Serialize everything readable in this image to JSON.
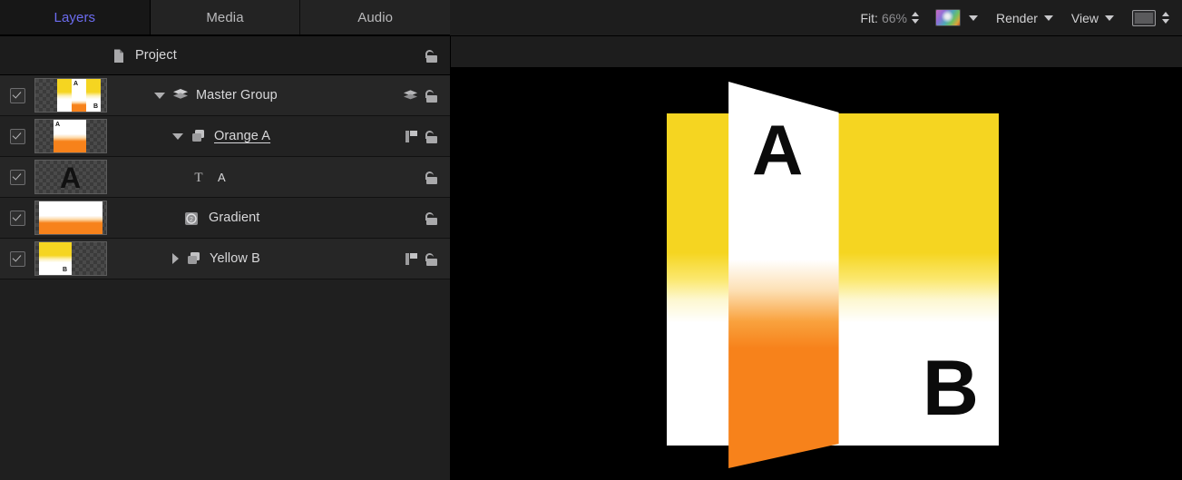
{
  "tabs": [
    {
      "id": "layers",
      "label": "Layers",
      "active": true
    },
    {
      "id": "media",
      "label": "Media",
      "active": false
    },
    {
      "id": "audio",
      "label": "Audio",
      "active": false
    }
  ],
  "toolbar": {
    "fit_label": "Fit:",
    "fit_value": "66%",
    "fit_stepper_icon": "stepper-up-down-icon",
    "color_swatch_icon": "color-wheel-swatch-icon",
    "color_swatch_chevron_icon": "chevron-down-icon",
    "render_label": "Render",
    "render_chevron_icon": "chevron-down-icon",
    "view_label": "View",
    "view_chevron_icon": "chevron-down-icon",
    "mask_button_icon": "rectangle-mask-icon",
    "mask_stepper_icon": "stepper-up-down-icon"
  },
  "layers_panel": {
    "project_row": {
      "icon": "document-icon",
      "label": "Project",
      "lock_icon": "unlocked-padlock-icon"
    },
    "rows": [
      {
        "id": "master-group",
        "label": "Master Group",
        "enabled": true,
        "checkbox_icon": "checkbox-checked-icon",
        "indent": 0,
        "disclosure": "open",
        "disclosure_icon": "triangle-down-icon",
        "kind_icon": "group-stack-icon",
        "extra_icon": "layers-stack-icon",
        "lock_icon": "unlocked-padlock-icon",
        "editing": false,
        "thumb": {
          "style": "master",
          "letters": [
            "A",
            "B"
          ]
        }
      },
      {
        "id": "orange-a",
        "label": "Orange A",
        "enabled": true,
        "checkbox_icon": "checkbox-checked-icon",
        "indent": 1,
        "disclosure": "open",
        "disclosure_icon": "triangle-down-icon",
        "kind_icon": "group-icon",
        "extra_icon": "group-flag-icon",
        "lock_icon": "unlocked-padlock-icon",
        "editing": true,
        "thumb": {
          "style": "orange",
          "letters": [
            "A"
          ]
        }
      },
      {
        "id": "text-a",
        "label": "A",
        "enabled": true,
        "checkbox_icon": "checkbox-checked-icon",
        "indent": 2,
        "disclosure": "none",
        "disclosure_icon": "",
        "kind_icon": "text-tool-icon",
        "extra_icon": "",
        "lock_icon": "unlocked-padlock-icon",
        "editing": false,
        "thumb": {
          "style": "letter-a",
          "letters": [
            "A"
          ]
        }
      },
      {
        "id": "gradient",
        "label": "Gradient",
        "enabled": true,
        "checkbox_icon": "checkbox-checked-icon",
        "indent": 2,
        "disclosure": "none",
        "disclosure_icon": "",
        "kind_icon": "gradient-generator-icon",
        "extra_icon": "",
        "lock_icon": "unlocked-padlock-icon",
        "editing": false,
        "thumb": {
          "style": "gradient-full",
          "letters": []
        }
      },
      {
        "id": "yellow-b",
        "label": "Yellow B",
        "enabled": true,
        "checkbox_icon": "checkbox-checked-icon",
        "indent": 1,
        "disclosure": "closed",
        "disclosure_icon": "triangle-right-icon",
        "kind_icon": "group-icon",
        "extra_icon": "group-flag-icon",
        "lock_icon": "unlocked-padlock-icon",
        "editing": false,
        "thumb": {
          "style": "yellow",
          "letters": [
            "B"
          ]
        }
      }
    ]
  },
  "canvas": {
    "background_color": "#000000",
    "plane_b": {
      "name": "yellow-b-plane",
      "letter": "B",
      "gradient_top_color": "#f5d521",
      "gradient_bottom_color": "#ffffff"
    },
    "plane_a": {
      "name": "orange-a-plane",
      "letter": "A",
      "gradient_top_color": "#ffffff",
      "gradient_bottom_color": "#f7821b"
    }
  },
  "colors": {
    "accent": "#6c6cf0",
    "yellow": "#f5d521",
    "orange": "#f7821b",
    "panel_bg": "#1f1f1f",
    "row_bg": "#262626"
  }
}
